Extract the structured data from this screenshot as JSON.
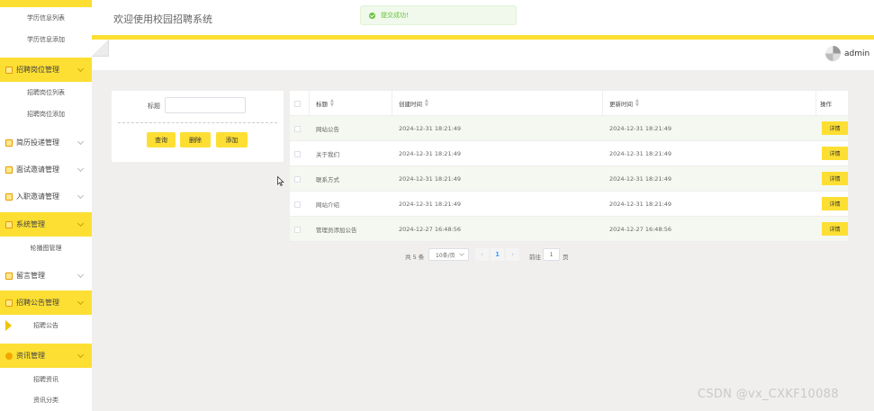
{
  "header": {
    "title": "欢迎使用校园招聘系统"
  },
  "toast": {
    "message": "提交成功!"
  },
  "user": {
    "name": "admin"
  },
  "sidebar": {
    "items": [
      {
        "type": "item",
        "label": "学历信息列表"
      },
      {
        "type": "item",
        "label": "学历信息添加"
      },
      {
        "type": "group",
        "label": "招聘岗位管理",
        "highlighted": true
      },
      {
        "type": "item",
        "label": "招聘岗位列表"
      },
      {
        "type": "item",
        "label": "招聘岗位添加"
      },
      {
        "type": "group",
        "label": "简历投递管理",
        "highlighted": false
      },
      {
        "type": "group",
        "label": "面试邀请管理",
        "highlighted": false
      },
      {
        "type": "group",
        "label": "入职邀请管理",
        "highlighted": false
      },
      {
        "type": "group",
        "label": "系统管理",
        "highlighted": true
      },
      {
        "type": "item",
        "label": "轮播图管理"
      },
      {
        "type": "group",
        "label": "留言管理",
        "highlighted": false
      },
      {
        "type": "group",
        "label": "招聘公告管理",
        "highlighted": true
      },
      {
        "type": "item",
        "label": "招聘公告",
        "active": true
      },
      {
        "type": "group",
        "label": "资讯管理",
        "highlighted": true
      },
      {
        "type": "item",
        "label": "招聘资讯"
      },
      {
        "type": "item",
        "label": "资讯分类"
      }
    ]
  },
  "search": {
    "label": "标题",
    "placeholder": "",
    "buttons": {
      "query": "查询",
      "delete": "删除",
      "add": "添加"
    }
  },
  "table": {
    "columns": {
      "title": "标题",
      "created": "创建时间",
      "updated": "更新时间",
      "action": "操作"
    },
    "detail_label": "详情",
    "rows": [
      {
        "title": "网站公告",
        "created": "2024-12-31 18:21:49",
        "updated": "2024-12-31 18:21:49"
      },
      {
        "title": "关于我们",
        "created": "2024-12-31 18:21:49",
        "updated": "2024-12-31 18:21:49"
      },
      {
        "title": "联系方式",
        "created": "2024-12-31 18:21:49",
        "updated": "2024-12-31 18:21:49"
      },
      {
        "title": "网站介绍",
        "created": "2024-12-31 18:21:49",
        "updated": "2024-12-31 18:21:49"
      },
      {
        "title": "管理员添加公告",
        "created": "2024-12-27 16:48:56",
        "updated": "2024-12-27 16:48:56"
      }
    ]
  },
  "pagination": {
    "total_text": "共 5 条",
    "page_size": "10条/页",
    "prev": "‹",
    "current_page": "1",
    "next": "›",
    "goto_label": "前往",
    "goto_value": "1",
    "page_suffix": "页"
  },
  "watermark": "CSDN @vx_CXKF10088",
  "colors": {
    "accent": "#fddf33",
    "success": "#67c23a",
    "background": "#f0efed"
  }
}
